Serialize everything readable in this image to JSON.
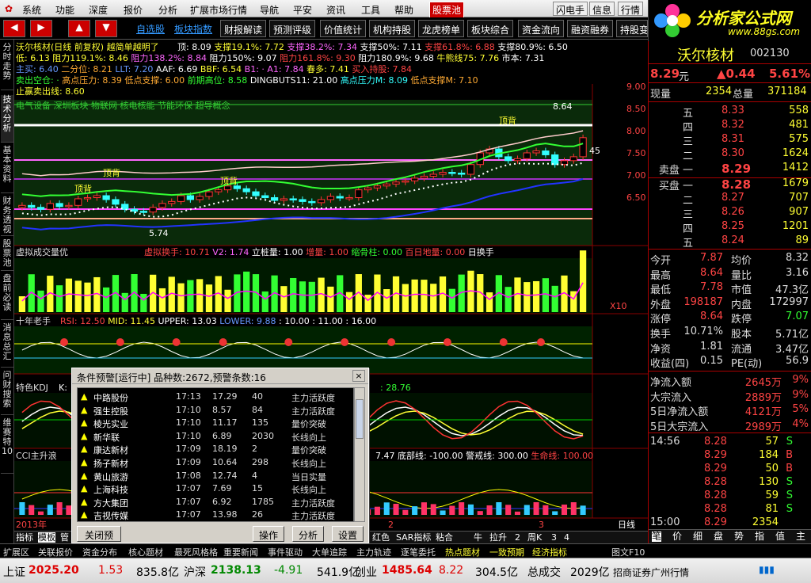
{
  "menu": {
    "items": [
      "系统",
      "功能",
      "深度",
      "报价",
      "分析",
      "扩展市场行情",
      "导航",
      "平安",
      "资讯",
      "工具",
      "帮助"
    ],
    "hot": "股票池",
    "right": [
      "闪电手",
      "信息",
      "行情"
    ]
  },
  "logo": {
    "title": "分析家公式网",
    "url": "www.88gs.com"
  },
  "toolbar": {
    "blue": [
      "自选股",
      "板块指数"
    ],
    "buttons": [
      "财报解读",
      "预测评级",
      "价值统计",
      "机构持股",
      "龙虎榜单",
      "板块综合",
      "资金流向",
      "融资融券",
      "持股变"
    ]
  },
  "sidebar": {
    "tabs": [
      "分时走势",
      "技术分析",
      "基本资料",
      "财务透视",
      "股票池",
      "盘前必读",
      "消息总汇",
      "问财搜索",
      "维赛特10"
    ]
  },
  "main_panel": {
    "header": "沃尔核材(日线 前复权) 越简单越明了",
    "line1": [
      [
        "顶: 8.09",
        "w"
      ],
      [
        "支撑19.1%: 7.72",
        "y"
      ],
      [
        "支撑38.2%: 7.34",
        "m"
      ],
      [
        "支撑50%: 7.11",
        "w"
      ],
      [
        "支撑61.8%: 6.88",
        "r"
      ],
      [
        "支撑80.9%: 6.50",
        "w"
      ]
    ],
    "line2": [
      [
        "低: 6.13",
        "y"
      ],
      [
        "阻力119.1%: 8.46",
        "y"
      ],
      [
        "阻力138.2%: 8.84",
        "m"
      ],
      [
        "阻力150%: 9.07",
        "w"
      ],
      [
        "阻力161.8%: 9.30",
        "r"
      ],
      [
        "阻力180.9%: 9.68",
        "w"
      ],
      [
        "牛熊线75: 7.76",
        "y"
      ],
      [
        "市本: 7.31",
        "w"
      ]
    ],
    "line3": [
      [
        "主买: 6.40",
        "b"
      ],
      [
        "二分位: 8.21",
        "o"
      ],
      [
        "LLT: 7.20",
        "b"
      ],
      [
        "AAF: 6.69",
        "w"
      ],
      [
        "BBF: 6.54",
        "y"
      ],
      [
        "B1: · A1: 7.84",
        "m"
      ],
      [
        "春多: 7.41",
        "y"
      ],
      [
        "买入持股: 7.84",
        "r"
      ]
    ],
    "line4": [
      [
        "卖出空仓: ·",
        "g"
      ],
      [
        "高点压力: 8.39",
        "o"
      ],
      [
        "低点支撑: 6.00",
        "o"
      ],
      [
        "前期高位: 8.58",
        "g"
      ],
      [
        "DINGBUTS11: 21.00",
        "w"
      ],
      [
        "高点压力M: 8.09",
        "c"
      ],
      [
        "低点支撑M: 7.10",
        "o"
      ]
    ],
    "line5": [
      [
        "止赢卖出线: 8.60",
        "y"
      ]
    ],
    "concepts": "电气设备 深圳板块 物联网 核电核能 节能环保 超导概念",
    "yticks": [
      "9.00",
      "8.50",
      "8.00",
      "7.50",
      "7.00",
      "6.50"
    ],
    "labels": {
      "hi": "8.64",
      "lo": "5.74",
      "mid": "45",
      "top1": "顶背",
      "top2": "顶背",
      "top3": "顶背",
      "top4": "顶背"
    }
  },
  "volume_panel": {
    "title": "虚拟成交量优",
    "items": [
      [
        "虚拟换手: 10.71",
        "r"
      ],
      [
        "V2: 1.74",
        "m"
      ],
      [
        "立桩量: 1.00",
        "w"
      ],
      [
        "增量: 1.00",
        "r"
      ],
      [
        "缩骨柱: 0.00",
        "g"
      ],
      [
        "百日地量: 0.00",
        "r"
      ],
      [
        "日换手",
        "w"
      ]
    ],
    "scale": "X10"
  },
  "rsi_panel": {
    "title": "十年老手",
    "items": [
      [
        "RSI: 12.50",
        "r"
      ],
      [
        "MID: 11.45",
        "y"
      ],
      [
        "UPPER: 13.03",
        "w"
      ],
      [
        "LOWER: 9.88",
        "b"
      ],
      [
        ": 10.00 : 11.00 : 16.00",
        "w"
      ]
    ]
  },
  "kdj_panel": {
    "title": "特色KDJ",
    "extra": "K:",
    "val": ": 28.76"
  },
  "cci_panel": {
    "title": "CCI主升浪",
    "items": [
      [
        "7.47",
        "w"
      ],
      [
        "底部线: -100.00",
        "w"
      ],
      [
        "警戒线: 300.00",
        "w"
      ],
      [
        "生命线: 100.00",
        "r"
      ]
    ]
  },
  "xaxis": {
    "year": "2013年",
    "m2": "2",
    "m3": "3"
  },
  "period_tabs": [
    "指标",
    "模板",
    "管",
    "红色",
    "SAR指标",
    "粘合",
    "牛",
    "拉升",
    "2",
    "周K",
    "3",
    "4"
  ],
  "period_label": "日线",
  "quote": {
    "name": "沃尔核材",
    "code": "002130",
    "price": "8.29",
    "unit": "元",
    "change": "▲0.44",
    "pct": "5.61%",
    "now_label": "现量",
    "now": "2354",
    "total_label": "总量",
    "total": "371184",
    "asks": [
      [
        "五",
        "8.33",
        "558"
      ],
      [
        "四",
        "8.32",
        "481"
      ],
      [
        "三",
        "8.31",
        "575"
      ],
      [
        "二",
        "8.30",
        "1624"
      ],
      [
        "卖盘 一",
        "8.29",
        "1412"
      ]
    ],
    "bids": [
      [
        "买盘 一",
        "8.28",
        "1679"
      ],
      [
        "二",
        "8.27",
        "707"
      ],
      [
        "三",
        "8.26",
        "907"
      ],
      [
        "四",
        "8.25",
        "1201"
      ],
      [
        "五",
        "8.24",
        "89"
      ]
    ],
    "stats": [
      [
        "今开",
        "7.87",
        "均价",
        "8.32"
      ],
      [
        "最高",
        "8.64",
        "量比",
        "3.16"
      ],
      [
        "最低",
        "7.78",
        "市值",
        "47.3亿"
      ],
      [
        "外盘",
        "198187",
        "内盘",
        "172997"
      ],
      [
        "涨停",
        "8.64",
        "跌停",
        "7.07"
      ],
      [
        "换手",
        "10.71%",
        "股本",
        "5.71亿"
      ],
      [
        "净资",
        "1.81",
        "流通",
        "3.47亿"
      ],
      [
        "收益(四)",
        "0.15",
        "PE(动)",
        "56.9"
      ]
    ],
    "flows": [
      [
        "净流入额",
        "2645万",
        "9%"
      ],
      [
        "大宗流入",
        "2889万",
        "9%"
      ],
      [
        "5日净流入额",
        "4121万",
        "5%"
      ],
      [
        "5日大宗流入",
        "2989万",
        "4%"
      ]
    ],
    "ticks": [
      [
        "14:56",
        "8.28",
        "57",
        "S"
      ],
      [
        "",
        "8.29",
        "184",
        "B"
      ],
      [
        "",
        "8.29",
        "50",
        "B"
      ],
      [
        "",
        "8.28",
        "130",
        "S"
      ],
      [
        "",
        "8.28",
        "59",
        "S"
      ],
      [
        "",
        "8.28",
        "81",
        "S"
      ],
      [
        "15:00",
        "8.29",
        "2354",
        ""
      ]
    ],
    "bottom_tabs": [
      "笔",
      "价",
      "细",
      "盘",
      "势",
      "指",
      "值",
      "主"
    ]
  },
  "alert": {
    "title": "条件预警[运行中] 品种数:2672,预警条数:16",
    "rows": [
      [
        "中路股份",
        "17:13",
        "17.29",
        "40",
        "主力活跃度"
      ],
      [
        "强生控股",
        "17:10",
        "8.57",
        "84",
        "主力活跃度"
      ],
      [
        "棱光实业",
        "17:10",
        "11.17",
        "135",
        "量价突破"
      ],
      [
        "新华联",
        "17:10",
        "6.89",
        "2030",
        "长线向上"
      ],
      [
        "康达新材",
        "17:09",
        "18.19",
        "2",
        "量价突破"
      ],
      [
        "扬子新材",
        "17:09",
        "10.64",
        "298",
        "长线向上"
      ],
      [
        "黄山旅游",
        "17:08",
        "12.74",
        "4",
        "当日实量"
      ],
      [
        "上海科技",
        "17:07",
        "7.69",
        "15",
        "长线向上"
      ],
      [
        "方大集团",
        "17:07",
        "6.92",
        "1785",
        "主力活跃度"
      ],
      [
        "吉视传媒",
        "17:07",
        "13.98",
        "26",
        "主力活跃度"
      ]
    ],
    "buttons": {
      "close": "关闭预警",
      "op": "操作",
      "analyze": "分析",
      "settings": "设置"
    }
  },
  "bottom_tabs": [
    "扩展区",
    "关联报价",
    "资金分布",
    "核心题材",
    "最死风格格",
    "重要新闻",
    "事件驱动",
    "大单追踪",
    "主力轨迹",
    "逐笔委托",
    "热点题材",
    "一致预期",
    "经济指标"
  ],
  "bottom_right": "图文F10",
  "statusbar": {
    "sh_label": "上证",
    "sh": "2025.20",
    "sh_chg": "1.53",
    "sh_amt": "835.8亿",
    "hs_label": "沪深",
    "hs": "2138.13",
    "hs_chg": "-4.91",
    "hs_amt": "541.9亿",
    "cy_label": "创业",
    "cy": "1485.64",
    "cy_chg": "8.22",
    "cy_amt": "304.5亿",
    "total_label": "总成交",
    "total": "2029亿",
    "broker": "招商证券广州行情"
  },
  "chart_data": {
    "type": "candlestick",
    "close": [
      6.55,
      6.5,
      6.45,
      6.6,
      6.52,
      6.55,
      6.72,
      6.75,
      6.8,
      6.7,
      6.58,
      6.45,
      6.4,
      6.38,
      6.5,
      6.6,
      6.65,
      6.8,
      6.7,
      6.78,
      6.9,
      6.95,
      7.05,
      6.98,
      6.9,
      6.8,
      6.75,
      6.68,
      6.72,
      6.7,
      6.65,
      6.62,
      6.7,
      6.78,
      6.74,
      6.75,
      6.95,
      7.0,
      7.05,
      7.1,
      7.15,
      7.18,
      7.25,
      7.3,
      7.35,
      7.4,
      7.38,
      7.35,
      7.6,
      7.9,
      8.0,
      7.8,
      7.7,
      7.75,
      7.9,
      7.95,
      7.85,
      7.6,
      7.7,
      7.8,
      8.29
    ],
    "ylim": [
      5.6,
      9.1
    ]
  }
}
